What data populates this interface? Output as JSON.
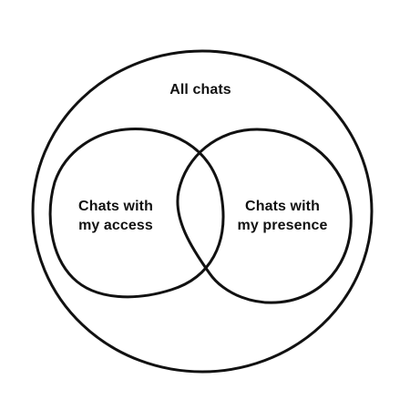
{
  "diagram": {
    "outer": {
      "label": "All chats"
    },
    "sets": [
      {
        "line1": "Chats with",
        "line2": "my access"
      },
      {
        "line1": "Chats with",
        "line2": "my presence"
      }
    ],
    "colors": {
      "stroke": "#111111",
      "background": "#ffffff",
      "text": "#111111"
    }
  }
}
